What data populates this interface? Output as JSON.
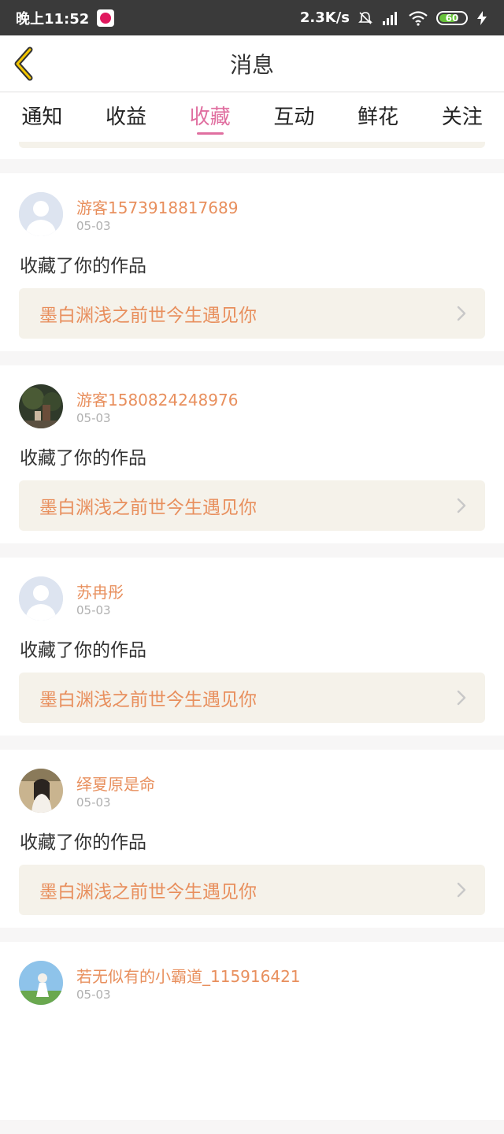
{
  "status": {
    "time": "晚上11:52",
    "speed": "2.3K/s",
    "battery": "60"
  },
  "header": {
    "title": "消息"
  },
  "tabs": [
    {
      "label": "通知",
      "active": false
    },
    {
      "label": "收益",
      "active": false
    },
    {
      "label": "收藏",
      "active": true
    },
    {
      "label": "互动",
      "active": false
    },
    {
      "label": "鲜花",
      "active": false
    },
    {
      "label": "关注",
      "active": false
    }
  ],
  "messages": [
    {
      "name": "游客1573918817689",
      "date": "05-03",
      "action": "收藏了你的作品",
      "work": "墨白渊浅之前世今生遇见你",
      "avatar": "default-avatar-icon"
    },
    {
      "name": "游客1580824248976",
      "date": "05-03",
      "action": "收藏了你的作品",
      "work": "墨白渊浅之前世今生遇见你",
      "avatar": "photo-avatar"
    },
    {
      "name": "苏冉彤",
      "date": "05-03",
      "action": "收藏了你的作品",
      "work": "墨白渊浅之前世今生遇见你",
      "avatar": "default-avatar-icon"
    },
    {
      "name": "绎夏原是命",
      "date": "05-03",
      "action": "收藏了你的作品",
      "work": "墨白渊浅之前世今生遇见你",
      "avatar": "photo-avatar"
    },
    {
      "name": "若无似有的小霸道_115916421",
      "date": "05-03",
      "action": "",
      "work": "",
      "avatar": "photo-avatar"
    }
  ],
  "colors": {
    "accent": "#e06fa0",
    "nameColor": "#e88f5d",
    "workBg": "#f5f2ea"
  }
}
